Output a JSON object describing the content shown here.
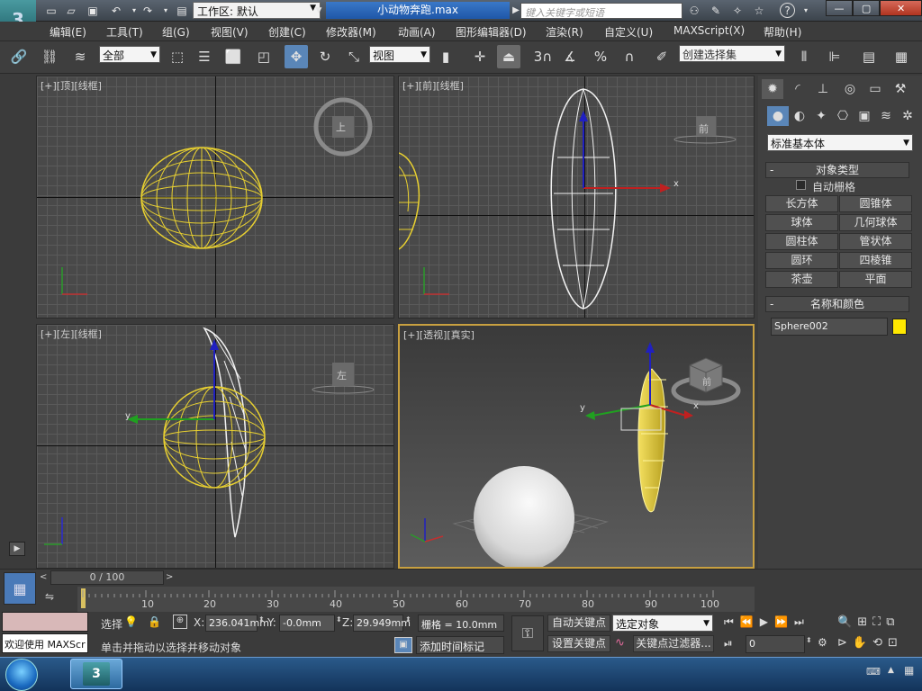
{
  "window": {
    "workspace_label": "工作区: 默认",
    "file_title": "小动物奔跑.max",
    "search_placeholder": "键入关键字或短语",
    "minimize": "—",
    "maximize": "▢",
    "close": "✕"
  },
  "logo": "3",
  "menu": [
    "编辑(E)",
    "工具(T)",
    "组(G)",
    "视图(V)",
    "创建(C)",
    "修改器(M)",
    "动画(A)",
    "图形编辑器(D)",
    "渲染(R)",
    "自定义(U)",
    "MAXScript(X)",
    "帮助(H)"
  ],
  "toolbar": {
    "filter_value": "全部",
    "ref_coord_value": "视图",
    "snap_label": "3",
    "selection_set_value": "创建选择集"
  },
  "viewports": {
    "top": {
      "label": "[+][顶][线框]",
      "cube": "上"
    },
    "front": {
      "label": "[+][前][线框]",
      "cube": "前",
      "axis_x": "x"
    },
    "left": {
      "label": "[+][左][线框]",
      "cube": "左",
      "axis_y": "y"
    },
    "perspective": {
      "label": "[+][透视][真实]",
      "cube": "前",
      "axis_x": "x",
      "axis_y": "y"
    }
  },
  "command_panel": {
    "category_value": "标准基本体",
    "object_type_title": "对象类型",
    "autogrid_label": "自动栅格",
    "buttons": [
      "长方体",
      "圆锥体",
      "球体",
      "几何球体",
      "圆柱体",
      "管状体",
      "圆环",
      "四棱锥",
      "茶壶",
      "平面"
    ],
    "name_color_title": "名称和颜色",
    "object_name": "Sphere002",
    "object_color": "#FFE800"
  },
  "timeline": {
    "slider_text": "0 / 100",
    "ticks": [
      "10",
      "20",
      "30",
      "40",
      "50",
      "60",
      "70",
      "80",
      "90",
      "100"
    ]
  },
  "status": {
    "listener_text": "欢迎使用 MAXScr",
    "selection_label": "选择",
    "x_label": "X:",
    "x_value": "236.041mm",
    "y_label": "Y:",
    "y_value": "-0.0mm",
    "z_label": "Z:",
    "z_value": "29.949mm",
    "grid_text": "栅格 = 10.0mm",
    "prompt": "单击并拖动以选择并移动对象",
    "add_time_tag": "添加时间标记",
    "auto_key": "自动关键点",
    "set_key": "设置关键点",
    "key_mode_value": "选定对象",
    "key_filters": "关键点过滤器...",
    "current_frame": "0"
  }
}
